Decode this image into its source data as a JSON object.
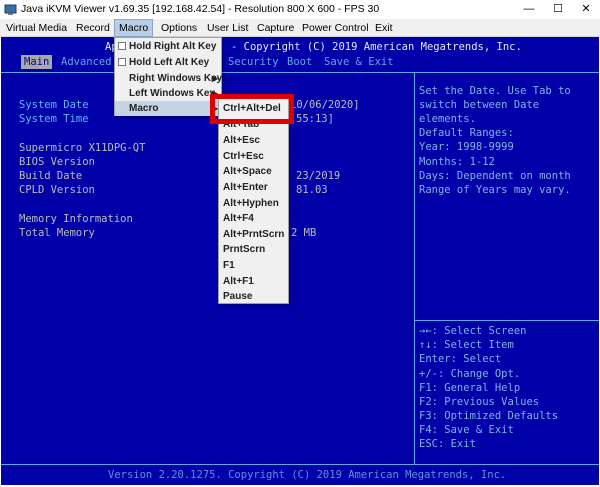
{
  "window": {
    "title": "Java iKVM Viewer v1.69.35 [192.168.42.54] - Resolution 800 X 600 - FPS 30",
    "min_glyph": "—",
    "max_glyph": "☐",
    "close_glyph": "✕"
  },
  "menubar": [
    "Virtual Media",
    "Record",
    "Macro",
    "Options",
    "User List",
    "Capture",
    "Power Control",
    "Exit"
  ],
  "macro_menu": {
    "items": [
      {
        "label": "Hold Right Alt Key",
        "checkbox": true,
        "arrow": ""
      },
      {
        "label": "Hold Left Alt Key",
        "checkbox": true,
        "arrow": ""
      },
      {
        "label": "Right Windows Key",
        "checkbox": false,
        "arrow": "▶"
      },
      {
        "label": "Left Windows Key",
        "checkbox": false,
        "arrow": "▶"
      },
      {
        "label": "Macro",
        "checkbox": false,
        "arrow": "▶"
      }
    ]
  },
  "macro_submenu": {
    "items": [
      "Ctrl+Alt+Del",
      "Alt+Tab",
      "Alt+Esc",
      "Ctrl+Esc",
      "Alt+Space",
      "Alt+Enter",
      "Alt+Hyphen",
      "Alt+F4",
      "Alt+PrntScrn",
      "PrntScrn",
      "F1",
      "Alt+F1",
      "Pause"
    ]
  },
  "bios": {
    "header_left": "Ap",
    "header_right": "- Copyright (C) 2019 American Megatrends, Inc.",
    "tabs": [
      "Main",
      "Advanced",
      "Security",
      "Boot",
      "Save & Exit"
    ],
    "system_date_label": "System Date",
    "system_date_value": "10/06/2020]",
    "system_time_label": "System Time",
    "system_time_value": "55:13]",
    "board_label": "Supermicro X11DPG-QT",
    "bios_version_label": "BIOS Version",
    "build_date_label": "Build Date",
    "build_date_value": "23/2019",
    "cpld_version_label": "CPLD Version",
    "cpld_version_value": "81.03",
    "memory_info_label": "Memory Information",
    "total_memory_label": "Total Memory",
    "total_memory_value": "2 MB",
    "help_lines": [
      "Set the Date. Use Tab to",
      "switch between Date",
      "elements.",
      "Default Ranges:",
      "Year: 1998-9999",
      "Months: 1-12",
      "Days: Dependent on month",
      "Range of Years may vary."
    ],
    "keys_lines": [
      "→←: Select Screen",
      "↑↓: Select Item",
      "Enter: Select",
      "+/-: Change Opt.",
      "F1: General Help",
      "F2: Previous Values",
      "F3: Optimized Defaults",
      "F4: Save & Exit",
      "ESC: Exit"
    ],
    "footer": "Version 2.20.1275. Copyright (C) 2019 American Megatrends, Inc."
  },
  "colors": {
    "bios_background": "#0000a8",
    "highlight_border": "#e00000",
    "menu_active": "#b8cde6"
  }
}
